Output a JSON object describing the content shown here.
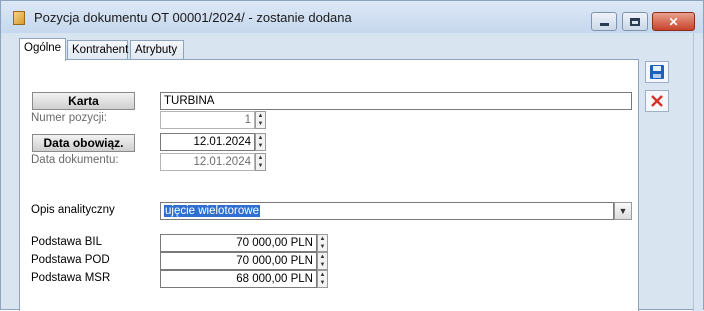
{
  "window": {
    "title": "Pozycja dokumentu OT  00001/2024/ - zostanie dodana",
    "close_glyph": "✕"
  },
  "tabs": [
    {
      "label": "Ogólne"
    },
    {
      "label": "Kontrahent"
    },
    {
      "label": "Atrybuty"
    }
  ],
  "form": {
    "karta": {
      "button_label": "Karta",
      "value": "TURBINA"
    },
    "numer_pozycji": {
      "label": "Numer pozycji:",
      "value": "1"
    },
    "data_obowiaz": {
      "button_label": "Data obowiąz.",
      "value": "12.01.2024"
    },
    "data_dokumentu": {
      "label": "Data dokumentu:",
      "value": "12.01.2024"
    },
    "opis_analityczny": {
      "label": "Opis analityczny",
      "value": "ujęcie wielotorowe"
    },
    "podstawa_bil": {
      "label": "Podstawa BIL",
      "value": "70 000,00 PLN"
    },
    "podstawa_pod": {
      "label": "Podstawa POD",
      "value": "70 000,00 PLN"
    },
    "podstawa_msr": {
      "label": "Podstawa MSR",
      "value": "68 000,00 PLN"
    }
  },
  "icons": {
    "save": "save-icon",
    "cancel": "close-icon"
  },
  "colors": {
    "selection": "#2f6fd0",
    "cancel_red": "#d9312a",
    "save_blue": "#1f5fb8"
  }
}
